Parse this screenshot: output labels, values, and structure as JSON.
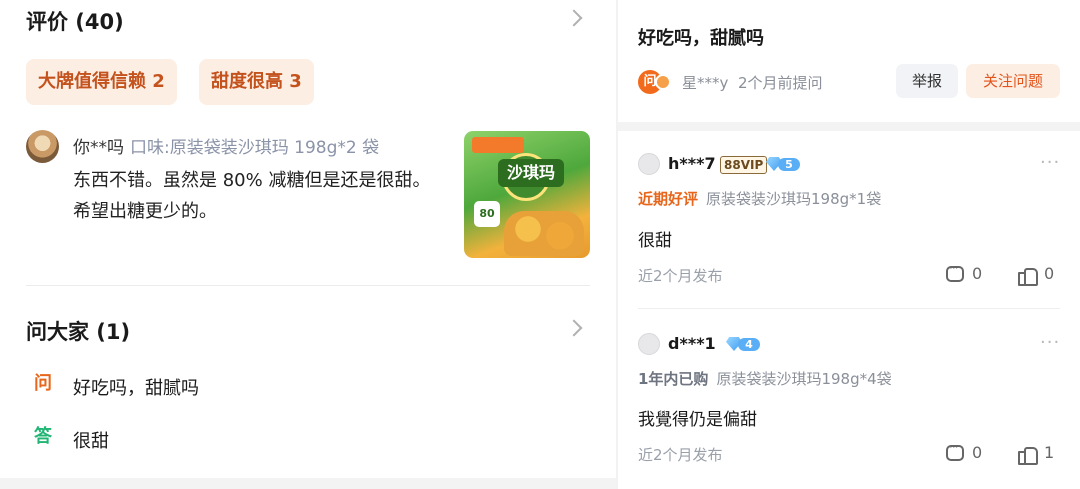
{
  "reviews_section": {
    "title": "评价 (40)",
    "tags": [
      {
        "label": "大牌值得信赖 2"
      },
      {
        "label": "甜度很高 3"
      }
    ],
    "review": {
      "user": "你**吗",
      "flavor": "口味:原装袋装沙琪玛 198g*2 袋",
      "text": "东西不错。虽然是 80% 减糖但是还是很甜。希望出糖更少的。",
      "image": {
        "name": "沙琪玛",
        "number": "80"
      }
    }
  },
  "qa_section": {
    "title": "问大家 (1)",
    "question_icon": "问",
    "question": "好吃吗，甜腻吗",
    "answer_icon": "答",
    "answer": "很甜"
  },
  "question_detail": {
    "title": "好吃吗，甜腻吗",
    "asker_icon": "问",
    "asker": "星***y",
    "time": "2个月前提问",
    "report_label": "举报",
    "follow_label": "关注问题"
  },
  "answers": [
    {
      "user": "h***7",
      "vip": "88VIP",
      "level": "5",
      "badge": "近期好评",
      "spec": "原装袋装沙琪玛198g*1袋",
      "text": "很甜",
      "time": "近2个月发布",
      "comments": "0",
      "likes": "0",
      "more": "···"
    },
    {
      "user": "d***1",
      "level": "4",
      "badge": "1年内已购",
      "spec": "原装袋装沙琪玛198g*4袋",
      "text": "我覺得仍是偏甜",
      "time": "近2个月发布",
      "comments": "0",
      "likes": "1",
      "more": "···"
    }
  ],
  "colors": {
    "accent": "#e8661b",
    "tag_bg": "#fdeee3",
    "answer_green": "#22b573"
  }
}
